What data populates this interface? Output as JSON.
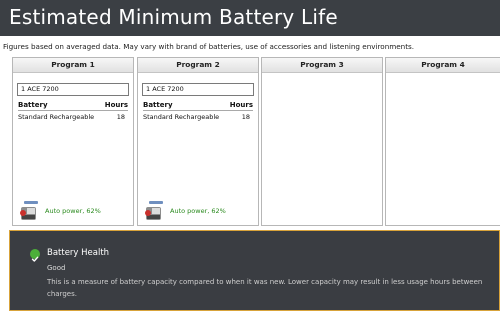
{
  "title": "Estimated Minimum Battery Life",
  "subtitle": "Figures based on averaged data. May vary with brand of batteries, use of accessories and listening environments.",
  "table_headers": {
    "battery": "Battery",
    "hours": "Hours"
  },
  "programs": [
    {
      "name": "Program 1",
      "device": "1 ACE 7200",
      "battery": "Standard Rechargeable",
      "hours": "18",
      "power_label": "Auto power, 62%",
      "power_level": 0.62
    },
    {
      "name": "Program 2",
      "device": "1 ACE 7200",
      "battery": "Standard Rechargeable",
      "hours": "18",
      "power_label": "Auto power, 62%",
      "power_level": 0.62
    },
    {
      "name": "Program 3"
    },
    {
      "name": "Program 4"
    }
  ],
  "health": {
    "title": "Battery Health",
    "status": "Good",
    "description": "This is a measure of battery capacity compared to when it was new. Lower capacity may result in less usage hours between charges.",
    "status_color": "#4caf3a"
  },
  "colors": {
    "title_bg": "#3b3f44",
    "power_label": "#2a8a1e",
    "panel_bg": "#3a3d42",
    "panel_border": "#d8a33a"
  },
  "icons": {
    "power": "battery-meter-icon",
    "health": "check-circle-icon"
  }
}
